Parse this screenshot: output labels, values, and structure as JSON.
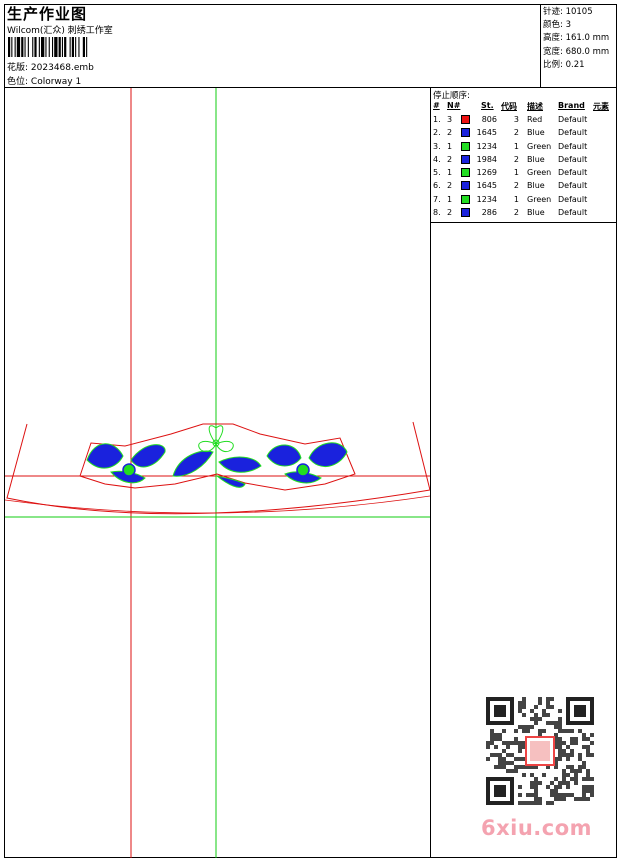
{
  "header": {
    "title": "生产作业图",
    "subtitle": "Wilcom(汇众) 刺绣工作室",
    "design_label": "花版:",
    "design_value": "2023468.emb",
    "colorway_label": "色位:",
    "colorway_value": "Colorway 1"
  },
  "stats": [
    {
      "label": "针迹:",
      "value": "10105"
    },
    {
      "label": "颜色:",
      "value": "3"
    },
    {
      "label": "高度:",
      "value": "161.0 mm"
    },
    {
      "label": "宽度:",
      "value": "680.0 mm"
    },
    {
      "label": "比例:",
      "value": "0.21"
    }
  ],
  "stop_sequence": {
    "title": "停止顺序:",
    "headers": {
      "idx": "#",
      "n": "N#",
      "st": "St.",
      "code": "代码",
      "desc": "描述",
      "brand": "Brand",
      "elem": "元素"
    },
    "rows": [
      {
        "idx": "1.",
        "n": "3",
        "color": "#ee1111",
        "st": "806",
        "code": "3",
        "desc": "Red",
        "brand": "Default"
      },
      {
        "idx": "2.",
        "n": "2",
        "color": "#1a22dd",
        "st": "1645",
        "code": "2",
        "desc": "Blue",
        "brand": "Default"
      },
      {
        "idx": "3.",
        "n": "1",
        "color": "#22dd22",
        "st": "1234",
        "code": "1",
        "desc": "Green",
        "brand": "Default"
      },
      {
        "idx": "4.",
        "n": "2",
        "color": "#1a22dd",
        "st": "1984",
        "code": "2",
        "desc": "Blue",
        "brand": "Default"
      },
      {
        "idx": "5.",
        "n": "1",
        "color": "#22dd22",
        "st": "1269",
        "code": "1",
        "desc": "Green",
        "brand": "Default"
      },
      {
        "idx": "6.",
        "n": "2",
        "color": "#1a22dd",
        "st": "1645",
        "code": "2",
        "desc": "Blue",
        "brand": "Default"
      },
      {
        "idx": "7.",
        "n": "1",
        "color": "#22dd22",
        "st": "1234",
        "code": "1",
        "desc": "Green",
        "brand": "Default"
      },
      {
        "idx": "8.",
        "n": "2",
        "color": "#1a22dd",
        "st": "286",
        "code": "2",
        "desc": "Blue",
        "brand": "Default"
      }
    ]
  },
  "watermark": {
    "text": "6xiu.com",
    "color": "#f4a3b0"
  },
  "colors": {
    "red_guide": "#dd1111",
    "green_guide": "#11cc11",
    "thread_blue": "#1a22dd",
    "thread_green": "#22dd22"
  }
}
